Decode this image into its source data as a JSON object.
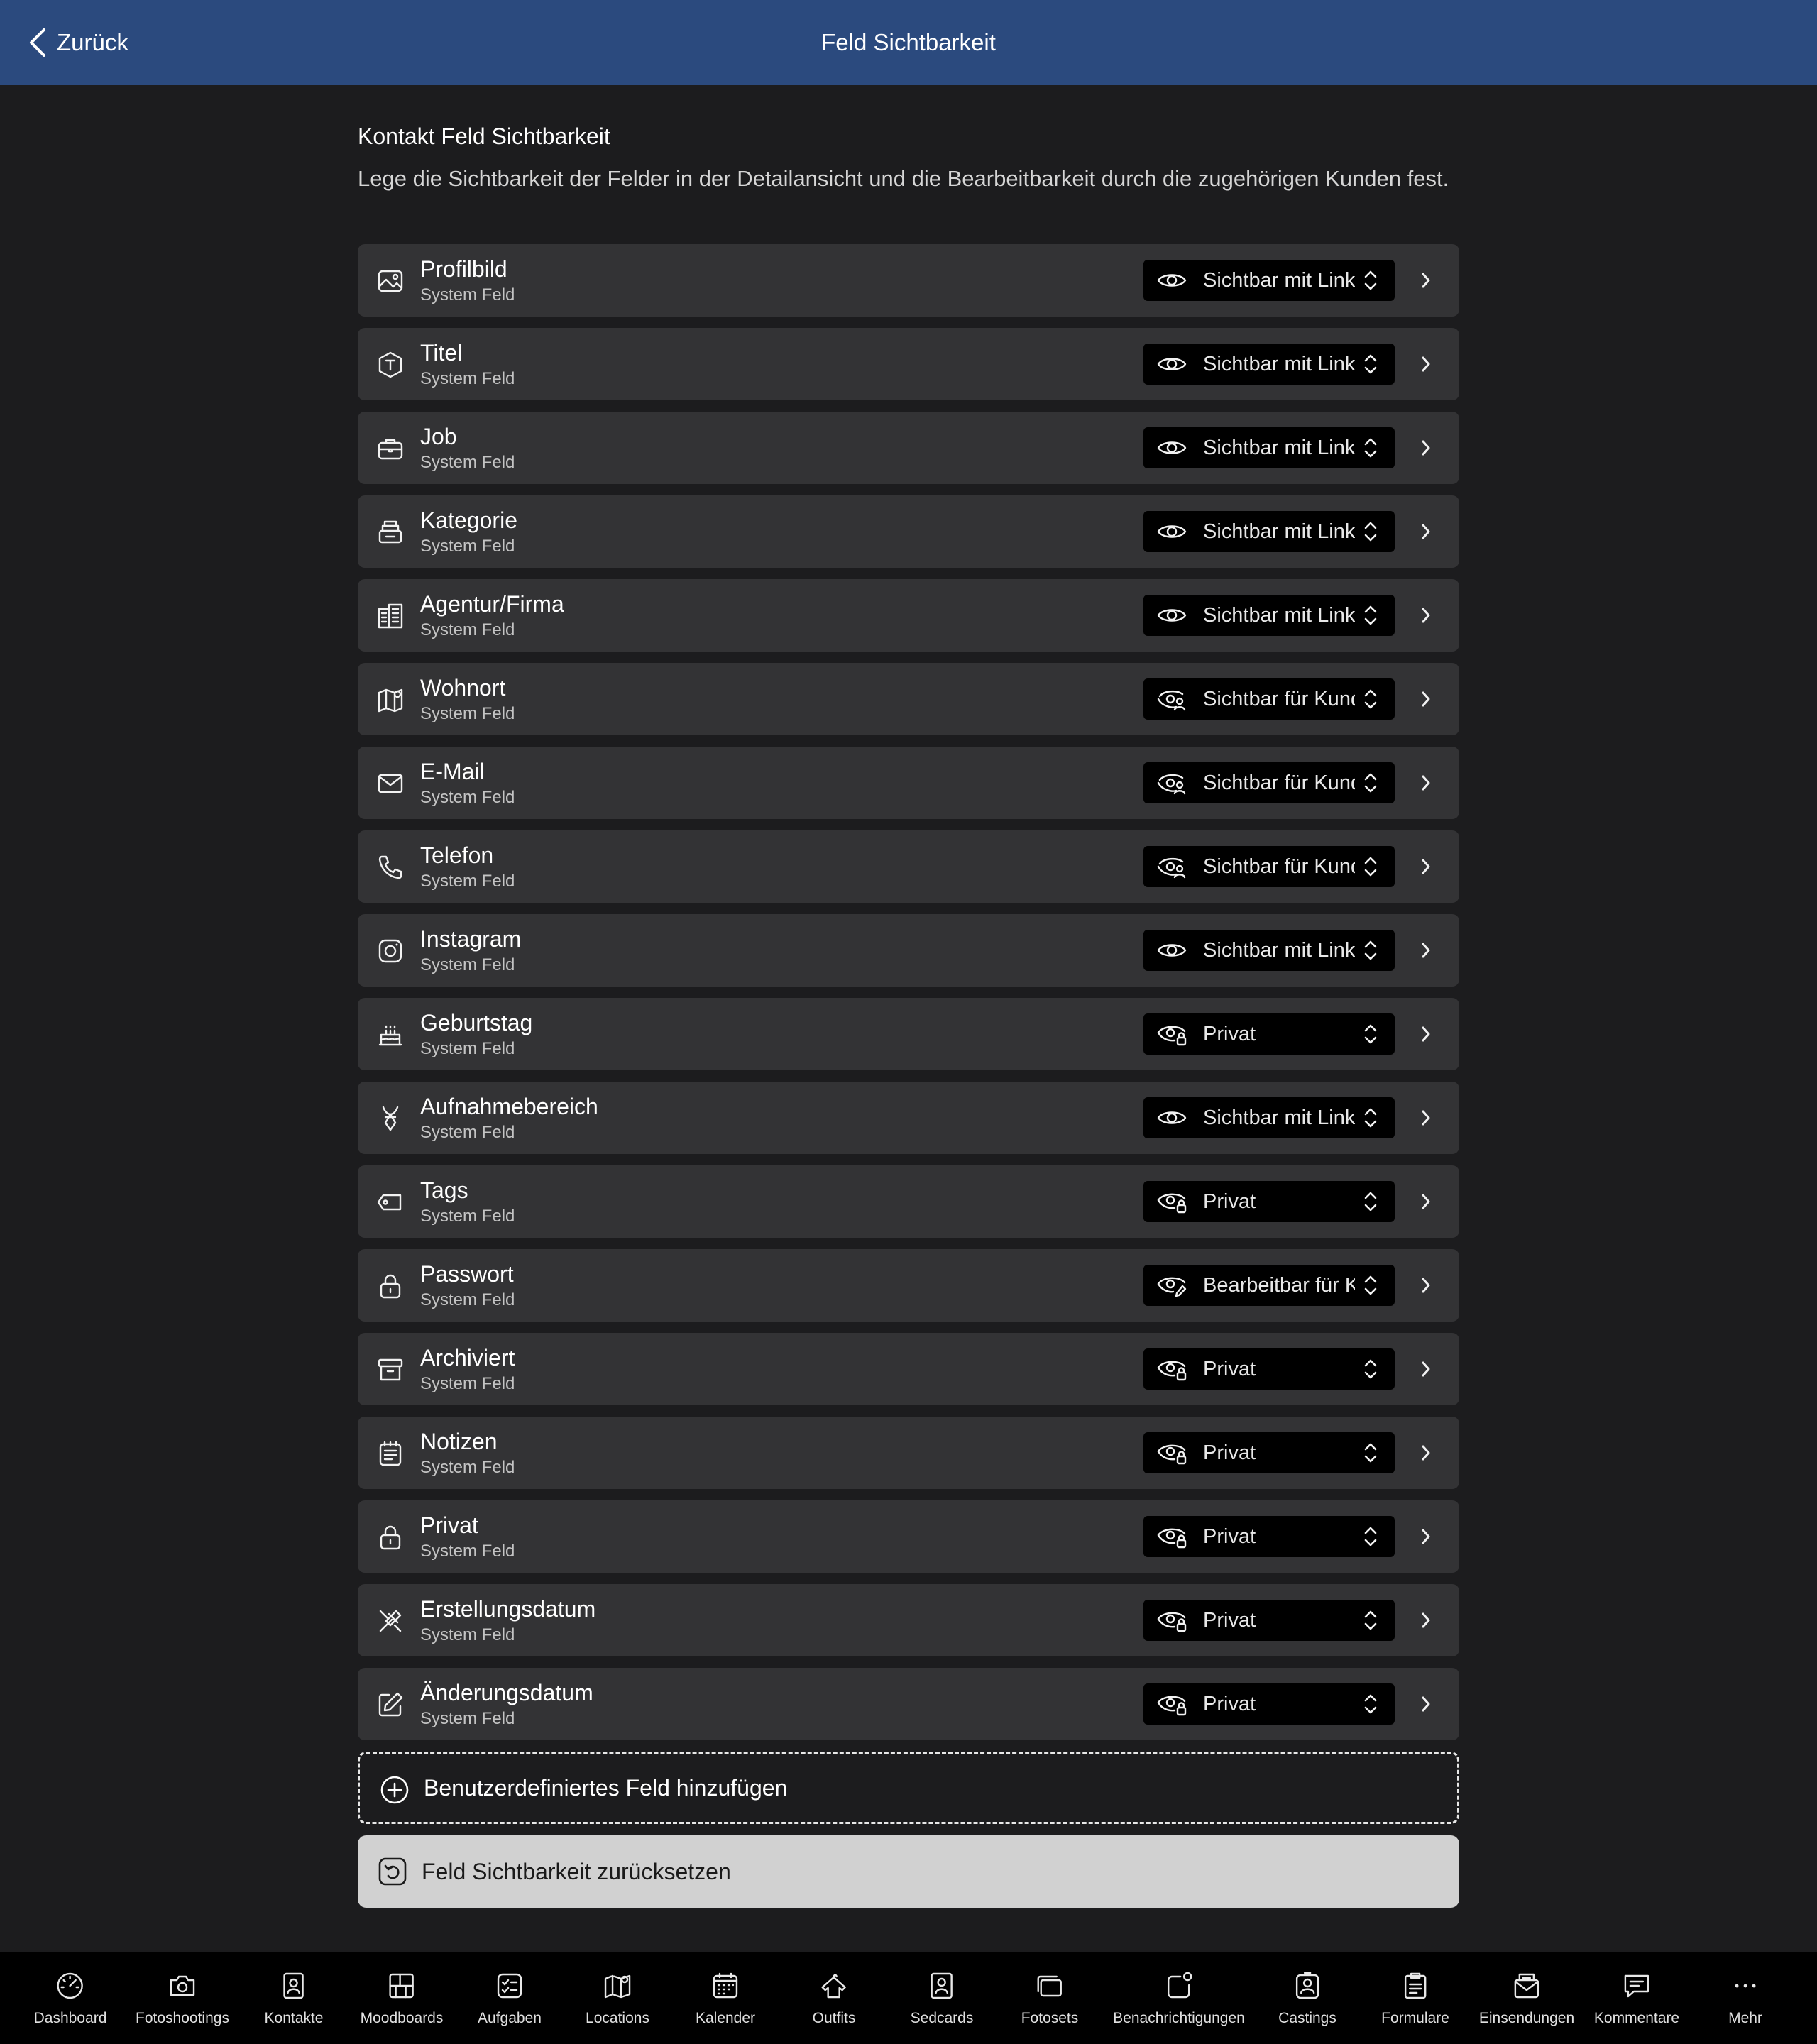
{
  "header": {
    "back_label": "Zurück",
    "title": "Feld Sichtbarkeit"
  },
  "section": {
    "title": "Kontakt Feld Sichtbarkeit",
    "description": "Lege die Sichtbarkeit der Felder in der Detailansicht und die Bearbeitbarkeit durch die zugehörigen Kunden fest."
  },
  "fields": [
    {
      "name": "Profilbild",
      "sub": "System Feld",
      "icon": "image-icon",
      "visibility": "Sichtbar mit Link",
      "vis_icon": "eye"
    },
    {
      "name": "Titel",
      "sub": "System Feld",
      "icon": "title-icon",
      "visibility": "Sichtbar mit Link",
      "vis_icon": "eye"
    },
    {
      "name": "Job",
      "sub": "System Feld",
      "icon": "briefcase-icon",
      "visibility": "Sichtbar mit Link",
      "vis_icon": "eye"
    },
    {
      "name": "Kategorie",
      "sub": "System Feld",
      "icon": "category-icon",
      "visibility": "Sichtbar mit Link",
      "vis_icon": "eye"
    },
    {
      "name": "Agentur/Firma",
      "sub": "System Feld",
      "icon": "building-icon",
      "visibility": "Sichtbar mit Link",
      "vis_icon": "eye"
    },
    {
      "name": "Wohnort",
      "sub": "System Feld",
      "icon": "map-icon",
      "visibility": "Sichtbar für Kunden",
      "vis_icon": "eye-user"
    },
    {
      "name": "E-Mail",
      "sub": "System Feld",
      "icon": "mail-icon",
      "visibility": "Sichtbar für Kunden",
      "vis_icon": "eye-user"
    },
    {
      "name": "Telefon",
      "sub": "System Feld",
      "icon": "phone-icon",
      "visibility": "Sichtbar für Kunden",
      "vis_icon": "eye-user"
    },
    {
      "name": "Instagram",
      "sub": "System Feld",
      "icon": "instagram-icon",
      "visibility": "Sichtbar mit Link",
      "vis_icon": "eye"
    },
    {
      "name": "Geburtstag",
      "sub": "System Feld",
      "icon": "cake-icon",
      "visibility": "Privat",
      "vis_icon": "eye-lock"
    },
    {
      "name": "Aufnahmebereich",
      "sub": "System Feld",
      "icon": "body-icon",
      "visibility": "Sichtbar mit Link",
      "vis_icon": "eye"
    },
    {
      "name": "Tags",
      "sub": "System Feld",
      "icon": "tag-icon",
      "visibility": "Privat",
      "vis_icon": "eye-lock"
    },
    {
      "name": "Passwort",
      "sub": "System Feld",
      "icon": "lock-icon",
      "visibility": "Bearbeitbar für Kunden",
      "vis_icon": "eye-edit"
    },
    {
      "name": "Archiviert",
      "sub": "System Feld",
      "icon": "archive-icon",
      "visibility": "Privat",
      "vis_icon": "eye-lock"
    },
    {
      "name": "Notizen",
      "sub": "System Feld",
      "icon": "notes-icon",
      "visibility": "Privat",
      "vis_icon": "eye-lock"
    },
    {
      "name": "Privat",
      "sub": "System Feld",
      "icon": "lock-icon",
      "visibility": "Privat",
      "vis_icon": "eye-lock"
    },
    {
      "name": "Erstellungsdatum",
      "sub": "System Feld",
      "icon": "tools-icon",
      "visibility": "Privat",
      "vis_icon": "eye-lock"
    },
    {
      "name": "Änderungsdatum",
      "sub": "System Feld",
      "icon": "edit-icon",
      "visibility": "Privat",
      "vis_icon": "eye-lock"
    }
  ],
  "actions": {
    "add_custom_field": "Benutzerdefiniertes Feld hinzufügen",
    "reset_visibility": "Feld Sichtbarkeit zurücksetzen"
  },
  "tabs": [
    {
      "label": "Dashboard",
      "icon": "dashboard-icon"
    },
    {
      "label": "Fotoshootings",
      "icon": "camera-icon"
    },
    {
      "label": "Kontakte",
      "icon": "contact-icon"
    },
    {
      "label": "Moodboards",
      "icon": "moodboard-icon"
    },
    {
      "label": "Aufgaben",
      "icon": "tasks-icon"
    },
    {
      "label": "Locations",
      "icon": "locations-icon"
    },
    {
      "label": "Kalender",
      "icon": "calendar-icon"
    },
    {
      "label": "Outfits",
      "icon": "outfit-icon"
    },
    {
      "label": "Sedcards",
      "icon": "sedcard-icon"
    },
    {
      "label": "Fotosets",
      "icon": "photosets-icon"
    },
    {
      "label": "Benachrichtigungen",
      "icon": "notification-icon"
    },
    {
      "label": "Castings",
      "icon": "casting-icon"
    },
    {
      "label": "Formulare",
      "icon": "form-icon"
    },
    {
      "label": "Einsendungen",
      "icon": "submission-icon"
    },
    {
      "label": "Kommentare",
      "icon": "comment-icon"
    },
    {
      "label": "Mehr",
      "icon": "more-icon"
    }
  ]
}
